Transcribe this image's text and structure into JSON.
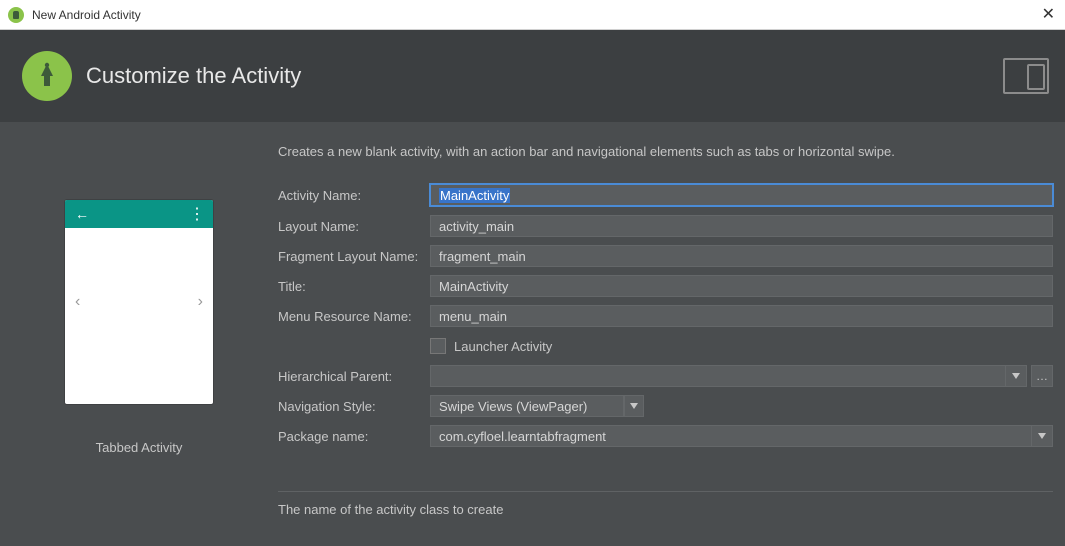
{
  "window": {
    "title": "New Android Activity",
    "close_glyph": "✕"
  },
  "header": {
    "title": "Customize the Activity"
  },
  "description": "Creates a new blank activity, with an action bar and navigational elements such as tabs or horizontal swipe.",
  "fields": {
    "activity_name": {
      "label": "Activity Name:",
      "value": "MainActivity"
    },
    "layout_name": {
      "label": "Layout Name:",
      "value": "activity_main"
    },
    "fragment_layout_name": {
      "label": "Fragment Layout Name:",
      "value": "fragment_main"
    },
    "title": {
      "label": "Title:",
      "value": "MainActivity"
    },
    "menu_resource_name": {
      "label": "Menu Resource Name:",
      "value": "menu_main"
    },
    "launcher_activity": {
      "label": "Launcher Activity",
      "checked": false
    },
    "hierarchical_parent": {
      "label": "Hierarchical Parent:",
      "value": ""
    },
    "navigation_style": {
      "label": "Navigation Style:",
      "value": "Swipe Views (ViewPager)"
    },
    "package_name": {
      "label": "Package name:",
      "value": "com.cyfloel.learntabfragment"
    }
  },
  "preview": {
    "caption": "Tabbed Activity",
    "back_glyph": "←",
    "overflow_glyph": "⋮",
    "left_glyph": "‹",
    "right_glyph": "›"
  },
  "hint": "The name of the activity class to create",
  "ellipsis": "…"
}
